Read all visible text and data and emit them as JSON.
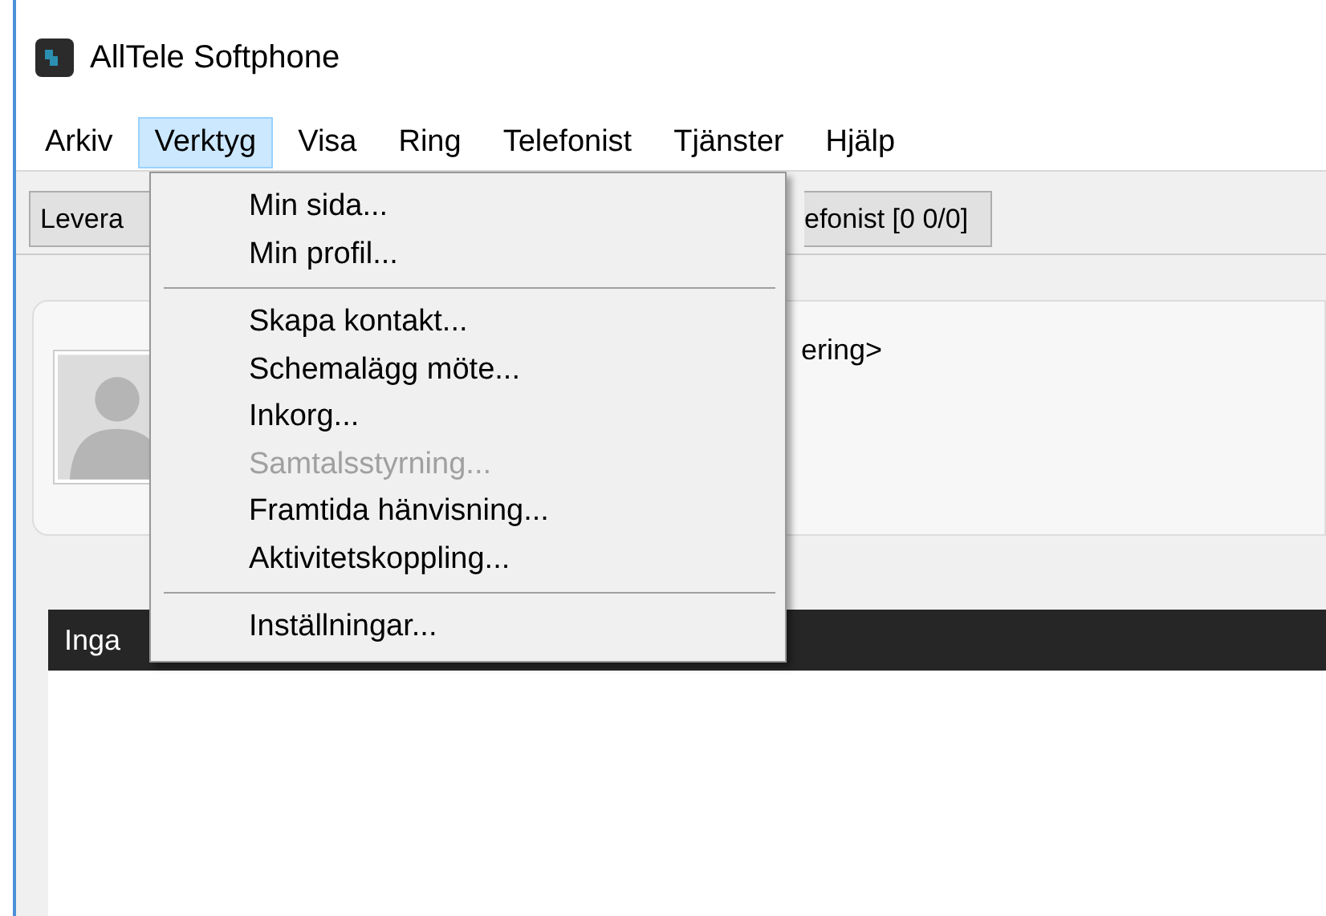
{
  "window": {
    "title": "AllTele Softphone"
  },
  "menu_bar": [
    {
      "label": "Arkiv",
      "selected": false
    },
    {
      "label": "Verktyg",
      "selected": true
    },
    {
      "label": "Visa",
      "selected": false
    },
    {
      "label": "Ring",
      "selected": false
    },
    {
      "label": "Telefonist",
      "selected": false
    },
    {
      "label": "Tjänster",
      "selected": false
    },
    {
      "label": "Hjälp",
      "selected": false
    }
  ],
  "toolbar": {
    "buttons": [
      "Levera",
      "efonist [0 0/0]"
    ]
  },
  "contact_card": {
    "status_text": "ering>"
  },
  "list_header": {
    "text": "Inga"
  },
  "dropdown_menu": [
    {
      "kind": "item",
      "label": "Min sida...",
      "disabled": false
    },
    {
      "kind": "item",
      "label": "Min profil...",
      "disabled": false
    },
    {
      "kind": "separator"
    },
    {
      "kind": "item",
      "label": "Skapa kontakt...",
      "disabled": false
    },
    {
      "kind": "item",
      "label": "Schemalägg möte...",
      "disabled": false
    },
    {
      "kind": "item",
      "label": "Inkorg...",
      "disabled": false
    },
    {
      "kind": "item",
      "label": "Samtalsstyrning...",
      "disabled": true
    },
    {
      "kind": "item",
      "label": "Framtida hänvisning...",
      "disabled": false
    },
    {
      "kind": "item",
      "label": "Aktivitetskoppling...",
      "disabled": false
    },
    {
      "kind": "separator"
    },
    {
      "kind": "item",
      "label": "Inställningar...",
      "disabled": false
    }
  ]
}
